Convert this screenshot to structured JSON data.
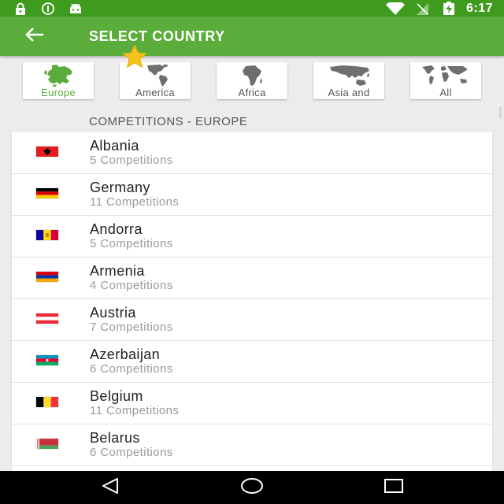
{
  "status_bar": {
    "time": "6:17",
    "icons_left": [
      "lock-icon",
      "info-icon",
      "android-icon"
    ],
    "icons_right": [
      "wifi-icon",
      "no-signal-icon",
      "battery-charging-icon"
    ]
  },
  "app_bar": {
    "title": "SELECT COUNTRY",
    "back_icon": "arrow-left-icon",
    "badge_icon": "star-icon",
    "color": "#5aad3a",
    "status_color": "#3f9b1e"
  },
  "region_tabs": [
    {
      "label": "Europe",
      "icon": "europe-map-icon",
      "selected": true
    },
    {
      "label": "America",
      "icon": "america-map-icon",
      "selected": false
    },
    {
      "label": "Africa",
      "icon": "africa-map-icon",
      "selected": false
    },
    {
      "label": "Asia and",
      "icon": "asia-map-icon",
      "selected": false
    },
    {
      "label": "All",
      "icon": "world-map-icon",
      "selected": false
    }
  ],
  "section_header": "COMPETITIONS - EUROPE",
  "countries": [
    {
      "name": "Albania",
      "competitions": "5 Competitions",
      "flag": "albania-flag-icon"
    },
    {
      "name": "Germany",
      "competitions": "11 Competitions",
      "flag": "germany-flag-icon"
    },
    {
      "name": "Andorra",
      "competitions": "5 Competitions",
      "flag": "andorra-flag-icon"
    },
    {
      "name": "Armenia",
      "competitions": "4 Competitions",
      "flag": "armenia-flag-icon"
    },
    {
      "name": "Austria",
      "competitions": "7 Competitions",
      "flag": "austria-flag-icon"
    },
    {
      "name": "Azerbaijan",
      "competitions": "6 Competitions",
      "flag": "azerbaijan-flag-icon"
    },
    {
      "name": "Belgium",
      "competitions": "11 Competitions",
      "flag": "belgium-flag-icon"
    },
    {
      "name": "Belarus",
      "competitions": "6 Competitions",
      "flag": "belarus-flag-icon"
    }
  ],
  "nav_bar": {
    "back": "triangle-back-icon",
    "home": "circle-home-icon",
    "recents": "square-recents-icon"
  }
}
